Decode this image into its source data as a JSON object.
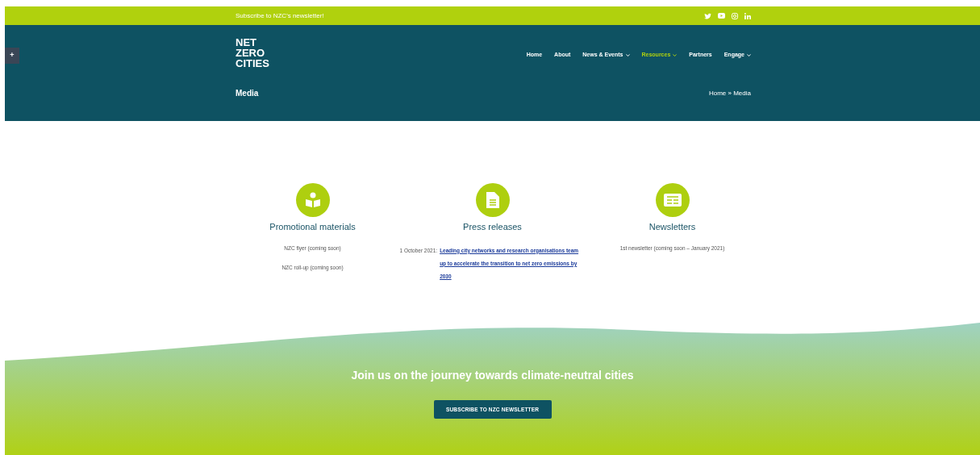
{
  "top_bar": {
    "newsletter_link": "Subscribe to NZC's newsletter!"
  },
  "header": {
    "logo": [
      "NET",
      "ZERO",
      "CITIES"
    ],
    "side_toggle": "+",
    "nav": [
      {
        "label": "Home",
        "kind": "link",
        "selected": false
      },
      {
        "label": "About",
        "kind": "link",
        "selected": false
      },
      {
        "label": "News & Events",
        "kind": "dropdown",
        "selected": false
      },
      {
        "label": "Resources",
        "kind": "dropdown",
        "selected": true
      },
      {
        "label": "Partners",
        "kind": "link",
        "selected": false
      },
      {
        "label": "Engage",
        "kind": "dropdown",
        "selected": false
      }
    ],
    "page_title": "Media",
    "breadcrumb": "Home » Media"
  },
  "sections": [
    {
      "kind": "promo",
      "title": "Promotional materials",
      "items": [
        {
          "text": "NZC flyer (coming soon)"
        },
        {
          "text": "NZC roll-up (coming soon)"
        }
      ]
    },
    {
      "kind": "press",
      "title": "Press releases",
      "items": [
        {
          "date": "1 October 2021:",
          "link": "Leading city networks and research organisations team up to accelerate the transition to net zero emissions by 2030"
        }
      ]
    },
    {
      "kind": "newsletter",
      "title": "Newsletters",
      "items": [
        {
          "text": "1st newsletter (coming soon – January 2021)"
        }
      ]
    }
  ],
  "footer": {
    "heading": "Join us on the journey towards climate-neutral cities",
    "button": "SUBSCRIBE TO NZC NEWSLETTER"
  }
}
